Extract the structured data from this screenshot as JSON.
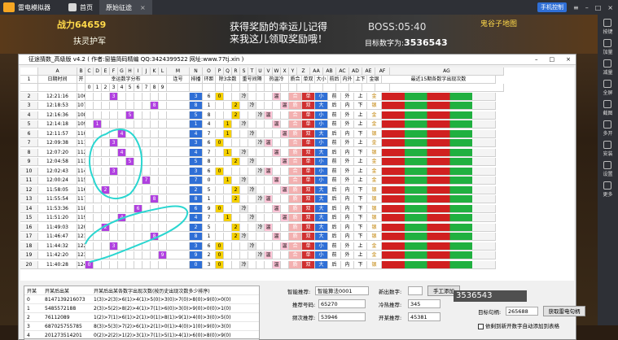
{
  "emulator": {
    "name": "雷电模拟器",
    "tabs": [
      {
        "label": "首页"
      },
      {
        "label": "原始征途"
      }
    ],
    "phone_button": "手机控制"
  },
  "sidebar": [
    {
      "label": "按键"
    },
    {
      "label": "加量"
    },
    {
      "label": "减量"
    },
    {
      "label": "全屏"
    },
    {
      "label": "截图"
    },
    {
      "label": "多开"
    },
    {
      "label": "安装"
    },
    {
      "label": "设置"
    },
    {
      "label": "更多"
    }
  ],
  "game": {
    "score": "战力64659",
    "sub": "扶灵护军",
    "message_line1": "获得奖励的幸运儿记得",
    "message_line2": "来我这儿领取奖励哦！",
    "boss": "BOSS:05:40",
    "target_label": "目标数字为:",
    "target_value": "3536543",
    "map": "鬼谷子地图"
  },
  "window": {
    "title": "征途猜数_高级版 v4.2 ( 作者:窗猫简码精编 QQ:3424399522 网址:www.77tj.xin )"
  },
  "grid": {
    "col_letters": [
      "A",
      "B",
      "C",
      "D",
      "E",
      "F",
      "G",
      "H",
      "I",
      "J",
      "K",
      "L",
      "M",
      "N",
      "O",
      "P",
      "Q",
      "R",
      "S",
      "T",
      "U",
      "V",
      "W",
      "X",
      "Y",
      "Z",
      "AA",
      "AB",
      "AC",
      "AD",
      "AE",
      "AF",
      "AG",
      "AH"
    ],
    "headers": {
      "idx": "1",
      "date": "日期时间",
      "open": "开",
      "dist": "幸运数字分布",
      "repeat": "连号",
      "order": "排播",
      "ring": "环距",
      "rem3": "除3余数",
      "repeat_dist": "重号间隔",
      "hot": "热温冷",
      "parity": "质合",
      "oddeven": "单双",
      "size": "大小",
      "frontback": "前后",
      "inout": "内外",
      "updown": "上下",
      "goldsilver": "金银",
      "last15": "最近15期各数字出现次数"
    },
    "rows": [
      {
        "n": "106",
        "t": "12:21:16",
        "d": "3"
      },
      {
        "n": "107",
        "t": "12:18:53",
        "d": "8"
      },
      {
        "n": "108",
        "t": "12:16:36",
        "d": "5"
      },
      {
        "n": "109",
        "t": "12:14:18",
        "d": "1"
      },
      {
        "n": "110",
        "t": "12:11:57",
        "d": "4"
      },
      {
        "n": "111",
        "t": "12:09:38",
        "d": "3"
      },
      {
        "n": "112",
        "t": "12:07:20",
        "d": "4"
      },
      {
        "n": "113",
        "t": "12:04:58",
        "d": "5"
      },
      {
        "n": "114",
        "t": "12:02:43",
        "d": "3"
      },
      {
        "n": "115",
        "t": "12:00:24",
        "d": "7"
      },
      {
        "n": "116",
        "t": "11:58:05",
        "d": "2"
      },
      {
        "n": "117",
        "t": "11:55:54",
        "d": "8"
      },
      {
        "n": "118",
        "t": "11:53:36",
        "d": "6"
      },
      {
        "n": "119",
        "t": "11:51:20",
        "d": "4"
      },
      {
        "n": "120",
        "t": "11:49:03",
        "d": "2"
      },
      {
        "n": "121",
        "t": "11:46:47",
        "d": "8"
      },
      {
        "n": "122",
        "t": "11:44:32",
        "d": "3"
      },
      {
        "n": "123",
        "t": "11:42:20",
        "d": "9"
      },
      {
        "n": "124",
        "t": "11:40:28",
        "d": "0"
      }
    ]
  },
  "bottom_table": {
    "headers": [
      "开某",
      "开某后出某",
      "开某后出某各数字出现次数(按历史出现次数多少排序)"
    ],
    "rows": [
      {
        "a": "0",
        "b": "8147139216073",
        "c": "1(3)>2(3)>6(1)>4(1)>5(0)>3(0)>7(0)>8(0)>9(0)>0(0)"
      },
      {
        "a": "1",
        "b": "5485572188",
        "c": "2(3)>5(2)>8(2)>4(1)>7(1)>6(0)>3(0)>9(0)>0(0)>1(0)"
      },
      {
        "a": "2",
        "b": "76112089",
        "c": "1(2)>7(1)>6(1)>2(1)>0(1)>8(1)>9(1)>4(0)>3(0)>5(0)"
      },
      {
        "a": "3",
        "b": "687025755785",
        "c": "8(3)>5(3)>7(2)>6(1)>2(1)>0(1)>4(0)>1(0)>9(0)>3(0)"
      },
      {
        "a": "4",
        "b": "201273514201",
        "c": "0(2)>2(2)>1(2)>3(1)>7(1)>5(1)>4(1)>6(0)>8(0)>9(0)"
      }
    ]
  },
  "form": {
    "smart_label": "智能推荐:",
    "smart_value": "智能算法0001",
    "add_label": "新出数字:",
    "manual_button": "手工添加",
    "recommend_label": "推荐号码:",
    "recommend_value": "65270",
    "coldhot_label": "冷热推荐:",
    "coldhot_value": "345",
    "freq_label": "频次推荐:",
    "freq_value": "53946",
    "kai_label": "开某推荐:",
    "kai_value": "45381",
    "big_value": "3536543",
    "target_handle_label": "目标句柄:",
    "target_handle_value": "265688",
    "get_handle_button": "获取雷电句柄",
    "auto_check_label": "依剩到新开数字自动添加到表格"
  }
}
